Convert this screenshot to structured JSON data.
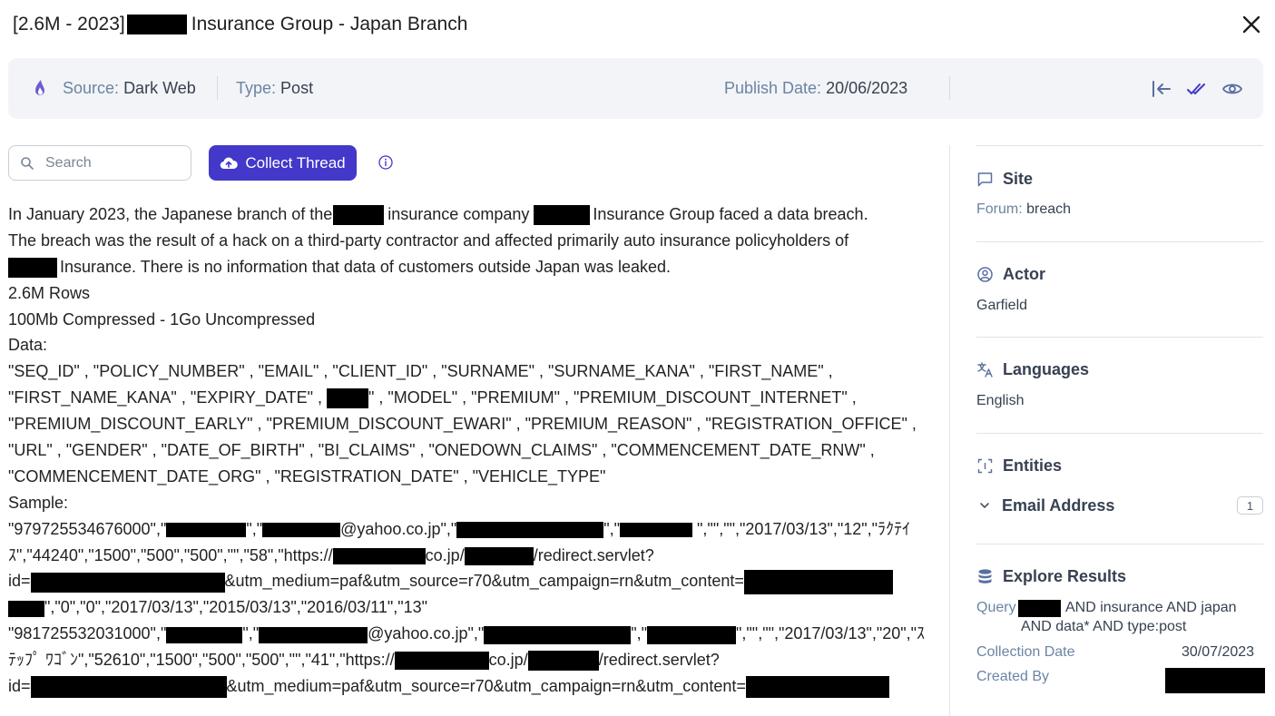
{
  "header": {
    "title_prefix": "[2.6M - 2023]",
    "title_suffix": "Insurance Group - Japan Branch"
  },
  "info_bar": {
    "source_label": "Source:",
    "source_value": "Dark Web",
    "type_label": "Type:",
    "type_value": "Post",
    "publish_label": "Publish Date:",
    "publish_value": "20/06/2023"
  },
  "toolbar": {
    "search_placeholder": "Search",
    "collect_label": "Collect Thread"
  },
  "post": {
    "line1_a": "In January 2023, the Japanese branch of the",
    "line1_b": "insurance company",
    "line1_c": "Insurance Group  faced a data breach.",
    "line2": "The breach was the result of a hack on a third-party contractor and affected primarily auto insurance policyholders of",
    "line3": "Insurance. There is no information that data of customers outside Japan was leaked.",
    "rows": "2.6M Rows",
    "size": "100Mb Compressed - 1Go Uncompressed",
    "data_label": "Data:",
    "fields1": "\"SEQ_ID\" , \"POLICY_NUMBER\" , \"EMAIL\" , \"CLIENT_ID\" , \"SURNAME\" , \"SURNAME_KANA\" , \"FIRST_NAME\" ,",
    "fields2_a": "\"FIRST_NAME_KANA\" , \"EXPIRY_DATE\" ,",
    "fields2_b": "\" , \"MODEL\" , \"PREMIUM\" , \"PREMIUM_DISCOUNT_INTERNET\" ,",
    "fields3": "\"PREMIUM_DISCOUNT_EARLY\" , \"PREMIUM_DISCOUNT_EWARI\" , \"PREMIUM_REASON\" , \"REGISTRATION_OFFICE\" ,",
    "fields4": "\"URL\" , \"GENDER\" , \"DATE_OF_BIRTH\" , \"BI_CLAIMS\" , \"ONEDOWN_CLAIMS\" , \"COMMENCEMENT_DATE_RNW\" ,",
    "fields5": "\"COMMENCEMENT_DATE_ORG\" , \"REGISTRATION_DATE\" , \"VEHICLE_TYPE\"",
    "sample_label": "Sample:",
    "s1_a": "\"979725534676000\",\"",
    "s1_b": "\",\"",
    "s1_c": "@yahoo.co.jp\",\"",
    "s1_d": "\",\"",
    "s1_e": " \",\"\",\"\",\"2017/03/13\",\"12\",\"ﾗｸﾃｲ",
    "s2_a": "ｽ\",\"44240\",\"1500\",\"500\",\"500\",\"\",\"58\",\"https://",
    "s2_b": "co.jp/",
    "s2_c": "/redirect.servlet?",
    "s3_a": "id=",
    "s3_b": "&utm_medium=paf&utm_source=r70&utm_campaign=rn&utm_content=",
    "s4": "\",\"0\",\"0\",\"2017/03/13\",\"2015/03/13\",\"2016/03/11\",\"13\"",
    "s5_a": "\"981725532031000\",\"",
    "s5_b": "\",\"",
    "s5_c": "@yahoo.co.jp\",\"",
    "s5_d": "\",\"",
    "s5_e": "\",\"\",\"\",\"2017/03/13\",\"20\",\"ｽ",
    "s6_a": "ﾃｯﾌﾟ ﾜｺﾞﾝ\",\"52610\",\"1500\",\"500\",\"500\",\"\",\"41\",\"https://",
    "s6_b": "co.jp/",
    "s6_c": "/redirect.servlet?",
    "s7_a": "id=",
    "s7_b": "&utm_medium=paf&utm_source=r70&utm_campaign=rn&utm_content="
  },
  "sidebar": {
    "site_title": "Site",
    "site_key": "Forum:",
    "site_value": "breach",
    "actor_title": "Actor",
    "actor_value": "Garfield",
    "languages_title": "Languages",
    "languages_value": "English",
    "entities_title": "Entities",
    "email_label": "Email Address",
    "email_count": "1",
    "explore_title": "Explore Results",
    "query_key": "Query",
    "query_line1": "AND insurance AND japan",
    "query_line2": "AND data* AND type:post",
    "collection_key": "Collection Date",
    "collection_value": "30/07/2023",
    "created_key": "Created By"
  },
  "colors": {
    "accent": "#4338ca",
    "muted_key": "#6b84a3",
    "panel_bg": "#f2f4f7"
  },
  "icons": [
    "dark-web-source-icon",
    "close-icon",
    "exit-icon",
    "double-check-icon",
    "eye-icon",
    "search-icon",
    "cloud-upload-icon",
    "info-icon",
    "chat-bubble-icon",
    "user-circle-icon",
    "translate-icon",
    "scan-brackets-icon",
    "chevron-down-icon",
    "database-icon"
  ]
}
